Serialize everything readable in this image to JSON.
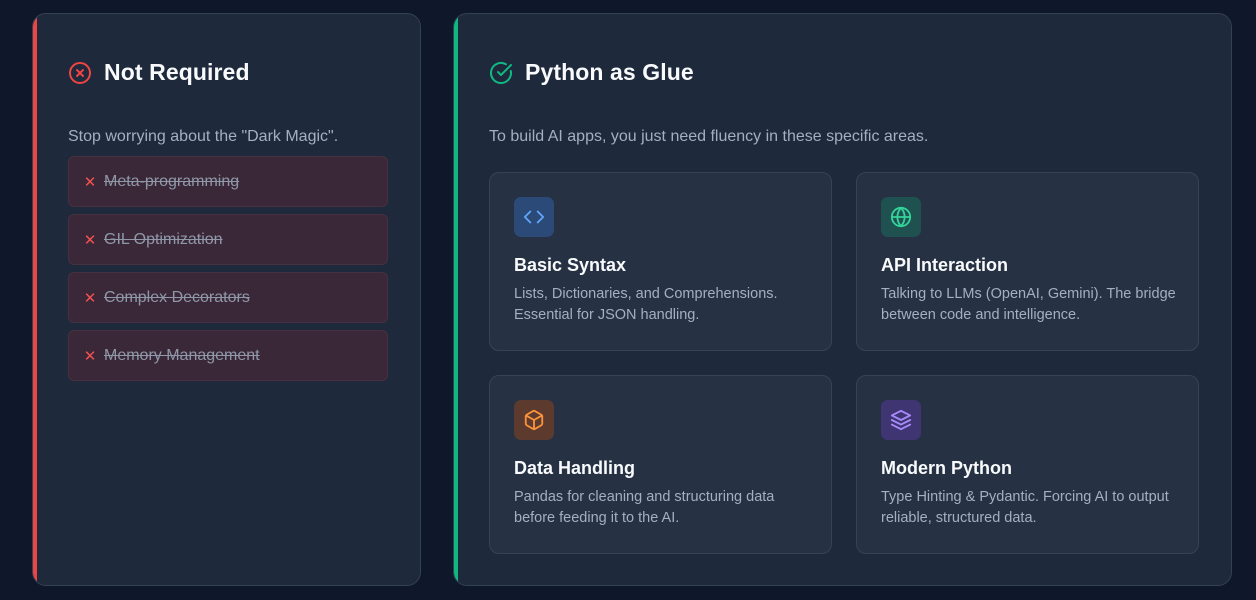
{
  "left_panel": {
    "title": "Not Required",
    "subtitle": "Stop worrying about the \"Dark Magic\".",
    "icon": "x-circle-icon",
    "accent": "#ef4444",
    "items": [
      {
        "label": "Meta-programming",
        "mark": "✕"
      },
      {
        "label": "GIL Optimization",
        "mark": "✕"
      },
      {
        "label": "Complex Decorators",
        "mark": "✕"
      },
      {
        "label": "Memory Management",
        "mark": "✕"
      }
    ]
  },
  "right_panel": {
    "title": "Python as Glue",
    "subtitle": "To build AI apps, you just need fluency in these specific areas.",
    "icon": "check-circle-icon",
    "accent": "#10b981",
    "cards": [
      {
        "title": "Basic Syntax",
        "description": "Lists, Dictionaries, and Comprehensions. Essential for JSON handling.",
        "icon": "code-icon",
        "color": "#3b82f6"
      },
      {
        "title": "API Interaction",
        "description": "Talking to LLMs (OpenAI, Gemini). The bridge between code and intelligence.",
        "icon": "globe-icon",
        "color": "#10b981"
      },
      {
        "title": "Data Handling",
        "description": "Pandas for cleaning and structuring data before feeding it to the AI.",
        "icon": "box-icon",
        "color": "#f97316"
      },
      {
        "title": "Modern Python",
        "description": "Type Hinting & Pydantic. Forcing AI to output reliable, structured data.",
        "icon": "layers-icon",
        "color": "#8b5cf6"
      }
    ]
  }
}
